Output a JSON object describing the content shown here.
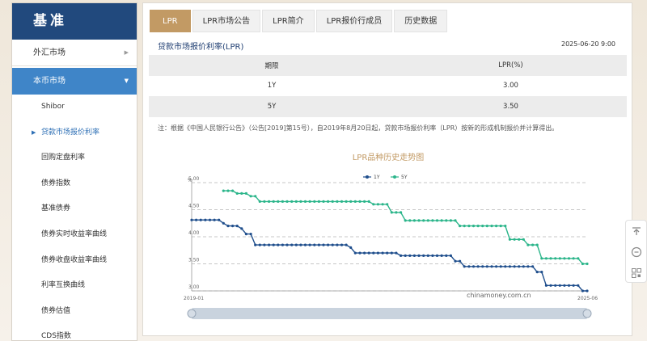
{
  "sidebar": {
    "title": "基准",
    "items": [
      {
        "label": "外汇市场",
        "arrow": "▶"
      },
      {
        "label": "本币市场",
        "arrow": "▼"
      }
    ],
    "subitems": [
      {
        "label": "Shibor"
      },
      {
        "label": "贷款市场报价利率",
        "marker": "▶"
      },
      {
        "label": "回购定盘利率"
      },
      {
        "label": "债券指数"
      },
      {
        "label": "基准债券"
      },
      {
        "label": "债券实时收益率曲线"
      },
      {
        "label": "债券收盘收益率曲线"
      },
      {
        "label": "利率互换曲线"
      },
      {
        "label": "债券估值"
      },
      {
        "label": "CDS指数"
      }
    ]
  },
  "tabs": [
    "LPR",
    "LPR市场公告",
    "LPR简介",
    "LPR报价行成员",
    "历史数据"
  ],
  "section_title": "贷款市场报价利率(LPR)",
  "date": "2025-06-20 9:00",
  "table": {
    "headers": [
      "期限",
      "LPR(%)"
    ],
    "rows": [
      [
        "1Y",
        "3.00"
      ],
      [
        "5Y",
        "3.50"
      ]
    ]
  },
  "note": "注：根据《中国人民银行公告》（公告[2019]第15号），自2019年8月20日起，贷款市场报价利率（LPR）按新的形成机制报价并计算得出。",
  "chart_data": {
    "type": "line",
    "title": "LPR品种历史走势图",
    "yunit": "%",
    "ylim": [
      3.0,
      5.0
    ],
    "yticks": [
      "5.00",
      "4.50",
      "4.00",
      "3.50",
      "3.00"
    ],
    "xticks": [
      "2019-01",
      "2025-06"
    ],
    "watermark": "chinamoney.com.cn",
    "legend_position": "top-center",
    "grid": true,
    "colors": {
      "1Y": "#1f4e8c",
      "5Y": "#2bb58a"
    },
    "series": [
      {
        "name": "1Y",
        "values": [
          4.31,
          4.31,
          4.31,
          4.31,
          4.31,
          4.31,
          4.31,
          4.25,
          4.2,
          4.2,
          4.2,
          4.15,
          4.05,
          4.05,
          3.85,
          3.85,
          3.85,
          3.85,
          3.85,
          3.85,
          3.85,
          3.85,
          3.85,
          3.85,
          3.85,
          3.85,
          3.85,
          3.85,
          3.85,
          3.85,
          3.85,
          3.85,
          3.85,
          3.85,
          3.85,
          3.8,
          3.7,
          3.7,
          3.7,
          3.7,
          3.7,
          3.7,
          3.7,
          3.7,
          3.7,
          3.7,
          3.65,
          3.65,
          3.65,
          3.65,
          3.65,
          3.65,
          3.65,
          3.65,
          3.65,
          3.65,
          3.65,
          3.65,
          3.55,
          3.55,
          3.45,
          3.45,
          3.45,
          3.45,
          3.45,
          3.45,
          3.45,
          3.45,
          3.45,
          3.45,
          3.45,
          3.45,
          3.45,
          3.45,
          3.45,
          3.45,
          3.35,
          3.35,
          3.1,
          3.1,
          3.1,
          3.1,
          3.1,
          3.1,
          3.1,
          3.1,
          3.0,
          3.0
        ]
      },
      {
        "name": "5Y",
        "values": [
          null,
          null,
          null,
          null,
          null,
          null,
          null,
          4.85,
          4.85,
          4.85,
          4.8,
          4.8,
          4.8,
          4.75,
          4.75,
          4.65,
          4.65,
          4.65,
          4.65,
          4.65,
          4.65,
          4.65,
          4.65,
          4.65,
          4.65,
          4.65,
          4.65,
          4.65,
          4.65,
          4.65,
          4.65,
          4.65,
          4.65,
          4.65,
          4.65,
          4.65,
          4.65,
          4.65,
          4.65,
          4.65,
          4.6,
          4.6,
          4.6,
          4.6,
          4.45,
          4.45,
          4.45,
          4.3,
          4.3,
          4.3,
          4.3,
          4.3,
          4.3,
          4.3,
          4.3,
          4.3,
          4.3,
          4.3,
          4.3,
          4.2,
          4.2,
          4.2,
          4.2,
          4.2,
          4.2,
          4.2,
          4.2,
          4.2,
          4.2,
          4.2,
          3.95,
          3.95,
          3.95,
          3.95,
          3.85,
          3.85,
          3.85,
          3.6,
          3.6,
          3.6,
          3.6,
          3.6,
          3.6,
          3.6,
          3.6,
          3.6,
          3.5,
          3.5
        ]
      }
    ]
  },
  "floatbar": {
    "icons": [
      "to-top-icon",
      "feedback-icon",
      "qr-code-icon"
    ]
  }
}
